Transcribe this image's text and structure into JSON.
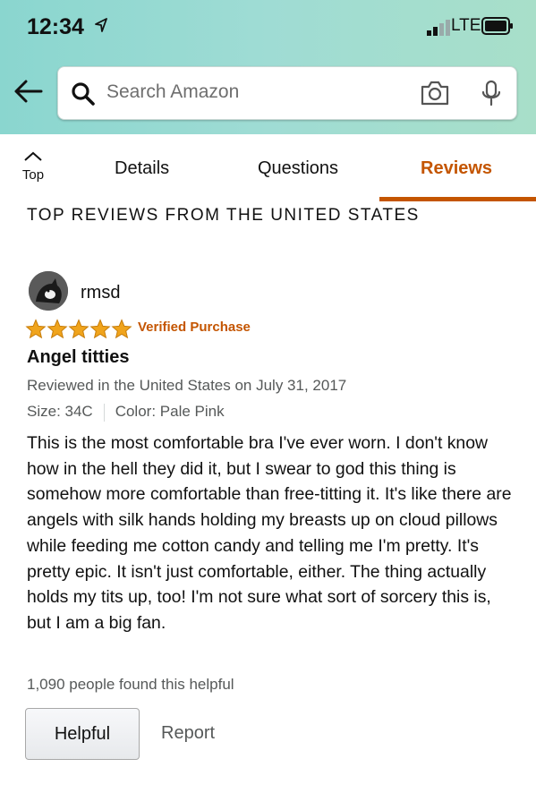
{
  "status_bar": {
    "time": "12:34",
    "network": "LTE"
  },
  "search": {
    "placeholder": "Search Amazon"
  },
  "tabs": {
    "top_label": "Top",
    "items": [
      {
        "label": "Details"
      },
      {
        "label": "Questions"
      },
      {
        "label": "Reviews",
        "active": true
      }
    ]
  },
  "section_title": "TOP REVIEWS FROM THE UNITED STATES",
  "review": {
    "reviewer": "rmsd",
    "rating": 5,
    "verified_label": "Verified Purchase",
    "title": "Angel titties",
    "date": "Reviewed in the United States on July 31, 2017",
    "size": "Size: 34C",
    "color": "Color: Pale Pink",
    "body": "This is the most comfortable bra I've ever worn. I don't know how in the hell they did it, but I swear to god this thing is somehow more comfortable than free-titting it. It's like there are angels with silk hands holding my breasts up on cloud pillows while feeding me cotton candy and telling me I'm pretty. It's pretty epic. It isn't just comfortable, either. The thing actually holds my tits up, too! I'm not sure what sort of sorcery this is, but I am a big fan.",
    "helpful_count": "1,090 people found this helpful",
    "helpful_button": "Helpful",
    "report_link": "Report"
  },
  "colors": {
    "accent": "#c45500",
    "star": "#f0a41c",
    "header_start": "#8ad6cf",
    "header_end": "#a8dfc9"
  },
  "icons": [
    "location-arrow-icon",
    "signal-icon",
    "battery-icon",
    "back-arrow-icon",
    "search-icon",
    "camera-icon",
    "mic-icon",
    "chevron-up-icon",
    "star-icon"
  ]
}
